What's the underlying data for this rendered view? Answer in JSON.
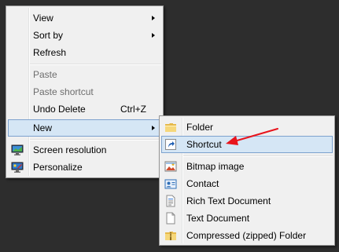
{
  "context_menu": {
    "items": [
      {
        "label": "View",
        "has_submenu": true
      },
      {
        "label": "Sort by",
        "has_submenu": true
      },
      {
        "label": "Refresh"
      },
      {
        "label": "Paste",
        "disabled": true
      },
      {
        "label": "Paste shortcut",
        "disabled": true
      },
      {
        "label": "Undo Delete",
        "shortcut": "Ctrl+Z"
      },
      {
        "label": "New",
        "has_submenu": true,
        "highlighted": true
      },
      {
        "label": "Screen resolution",
        "icon": "screen-resolution-icon"
      },
      {
        "label": "Personalize",
        "icon": "personalize-icon"
      }
    ]
  },
  "new_submenu": {
    "items": [
      {
        "label": "Folder",
        "icon": "folder-icon"
      },
      {
        "label": "Shortcut",
        "icon": "shortcut-icon",
        "highlighted": true
      },
      {
        "label": "Bitmap image",
        "icon": "bitmap-image-icon"
      },
      {
        "label": "Contact",
        "icon": "contact-icon"
      },
      {
        "label": "Rich Text Document",
        "icon": "rich-text-document-icon"
      },
      {
        "label": "Text Document",
        "icon": "text-document-icon"
      },
      {
        "label": "Compressed (zipped) Folder",
        "icon": "zipped-folder-icon"
      }
    ]
  },
  "colors": {
    "desktop_background": "#2d2d2d",
    "menu_background": "#f0f0f0",
    "highlight_fill": "#d5e6f5",
    "highlight_border": "#7da2ce",
    "annotation_arrow": "#e8141c"
  }
}
